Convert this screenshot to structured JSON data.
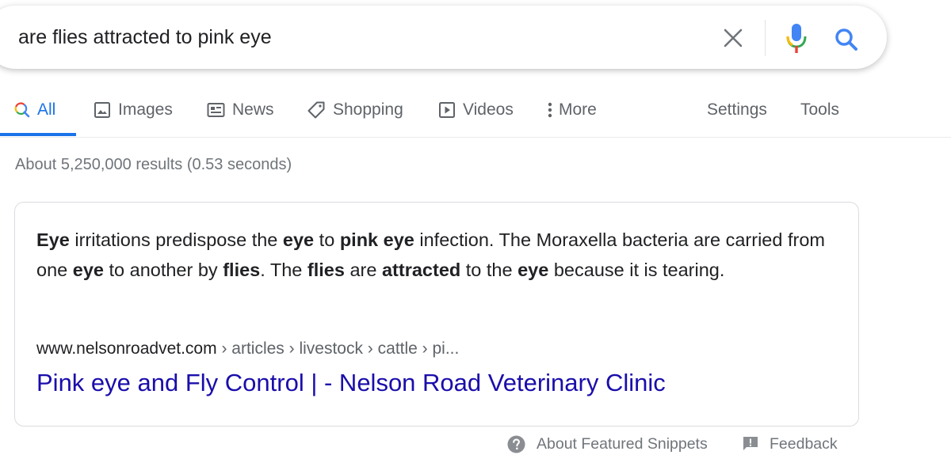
{
  "search": {
    "query": "are flies attracted to pink eye"
  },
  "tabs": [
    {
      "label": "All",
      "icon": "search-icon",
      "active": true
    },
    {
      "label": "Images",
      "icon": "image-icon"
    },
    {
      "label": "News",
      "icon": "news-icon"
    },
    {
      "label": "Shopping",
      "icon": "tag-icon"
    },
    {
      "label": "Videos",
      "icon": "play-icon"
    },
    {
      "label": "More",
      "icon": "more-vert-icon"
    },
    {
      "label": "Settings"
    },
    {
      "label": "Tools"
    }
  ],
  "results": {
    "stats": "About 5,250,000 results (0.53 seconds)"
  },
  "snippet": {
    "segments": [
      {
        "text": "Eye",
        "bold": true
      },
      {
        "text": " irritations predispose the ",
        "bold": false
      },
      {
        "text": "eye",
        "bold": true
      },
      {
        "text": " to ",
        "bold": false
      },
      {
        "text": "pink eye",
        "bold": true
      },
      {
        "text": " infection. The Moraxella bacteria are carried from one ",
        "bold": false
      },
      {
        "text": "eye",
        "bold": true
      },
      {
        "text": " to another by ",
        "bold": false
      },
      {
        "text": "flies",
        "bold": true
      },
      {
        "text": ". The ",
        "bold": false
      },
      {
        "text": "flies",
        "bold": true
      },
      {
        "text": " are ",
        "bold": false
      },
      {
        "text": "attracted",
        "bold": true
      },
      {
        "text": " to the ",
        "bold": false
      },
      {
        "text": "eye",
        "bold": true
      },
      {
        "text": " because it is tearing.",
        "bold": false
      }
    ],
    "url_domain": "www.nelsonroadvet.com",
    "url_path": " › articles › livestock › cattle › pi...",
    "title": "Pink eye and Fly Control | - Nelson Road Veterinary Clinic"
  },
  "footer": {
    "about_label": "About Featured Snippets",
    "feedback_label": "Feedback"
  },
  "colors": {
    "link": "#1a0dab",
    "accent": "#1a73e8",
    "muted": "#70757a"
  }
}
